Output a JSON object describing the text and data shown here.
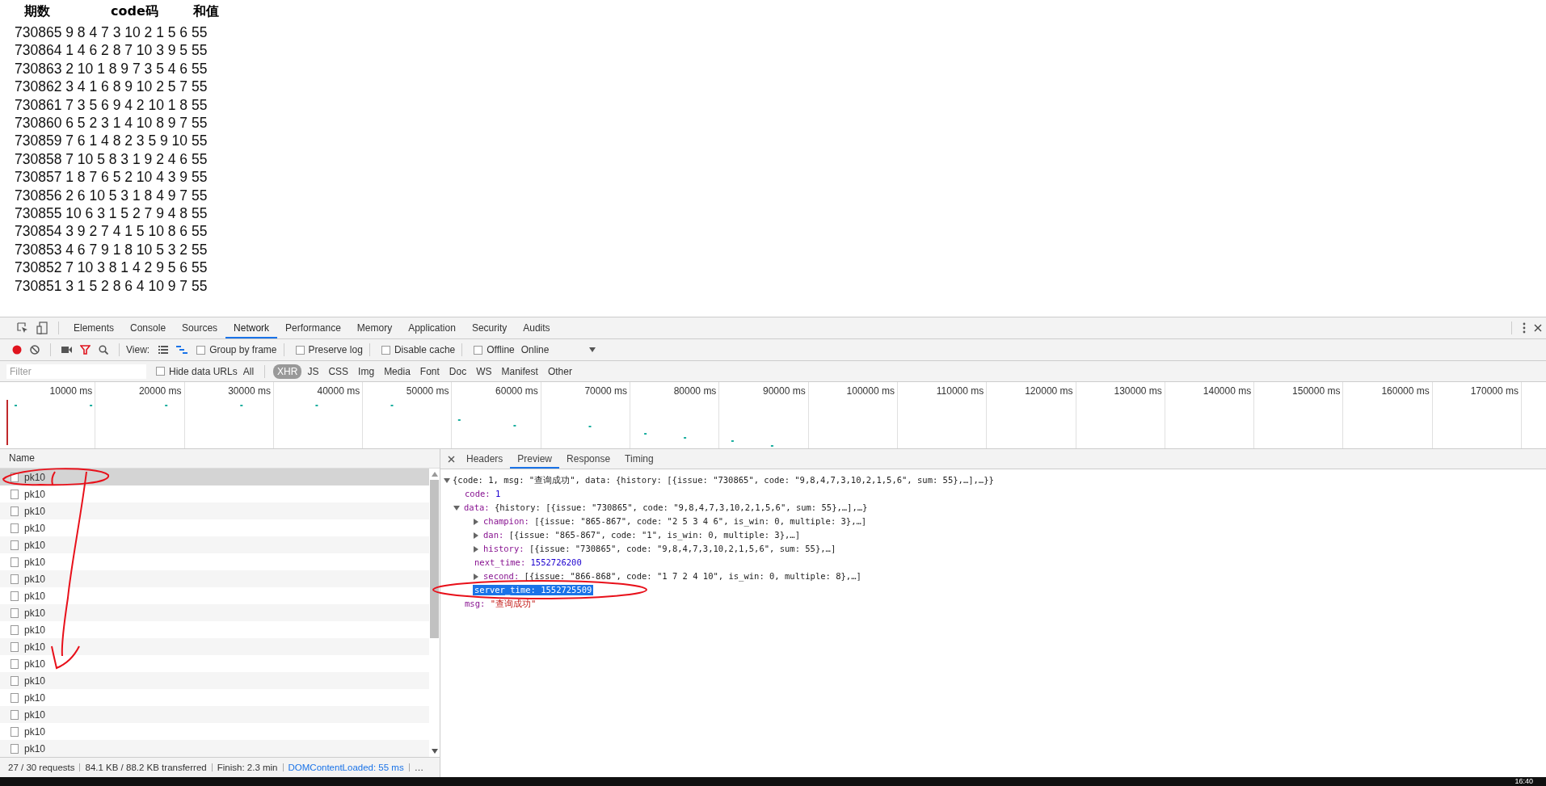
{
  "page": {
    "headers": [
      "期数",
      "code码",
      "和值"
    ],
    "rows": [
      "730865 9 8 4 7 3 10 2 1 5 6 55",
      "730864 1 4 6 2 8 7 10 3 9 5 55",
      "730863 2 10 1 8 9 7 3 5 4 6 55",
      "730862 3 4 1 6 8 9 10 2 5 7 55",
      "730861 7 3 5 6 9 4 2 10 1 8 55",
      "730860 6 5 2 3 1 4 10 8 9 7 55",
      "730859 7 6 1 4 8 2 3 5 9 10 55",
      "730858 7 10 5 8 3 1 9 2 4 6 55",
      "730857 1 8 7 6 5 2 10 4 3 9 55",
      "730856 2 6 10 5 3 1 8 4 9 7 55",
      "730855 10 6 3 1 5 2 7 9 4 8 55",
      "730854 3 9 2 7 4 1 5 10 8 6 55",
      "730853 4 6 7 9 1 8 10 5 3 2 55",
      "730852 7 10 3 8 1 4 2 9 5 6 55",
      "730851 3 1 5 2 8 6 4 10 9 7 55"
    ]
  },
  "devtools": {
    "tabs": [
      {
        "label": "Elements",
        "selected": false
      },
      {
        "label": "Console",
        "selected": false
      },
      {
        "label": "Sources",
        "selected": false
      },
      {
        "label": "Network",
        "selected": true
      },
      {
        "label": "Performance",
        "selected": false
      },
      {
        "label": "Memory",
        "selected": false
      },
      {
        "label": "Application",
        "selected": false
      },
      {
        "label": "Security",
        "selected": false
      },
      {
        "label": "Audits",
        "selected": false
      }
    ],
    "toolbar": {
      "recording": true,
      "filter_active": true,
      "view_label": "View:",
      "waterfall_selected": true,
      "checkboxes": [
        {
          "label": "Group by frame",
          "checked": false
        },
        {
          "label": "Preserve log",
          "checked": false
        },
        {
          "label": "Disable cache",
          "checked": false
        },
        {
          "label": "Offline",
          "checked": false
        }
      ],
      "throttle": "Online"
    },
    "filter": {
      "placeholder": "Filter",
      "hide_data_urls": {
        "label": "Hide data URLs",
        "checked": false
      },
      "types": [
        {
          "label": "All",
          "selected": false
        },
        {
          "label": "XHR",
          "selected": true
        },
        {
          "label": "JS",
          "selected": false
        },
        {
          "label": "CSS",
          "selected": false
        },
        {
          "label": "Img",
          "selected": false
        },
        {
          "label": "Media",
          "selected": false
        },
        {
          "label": "Font",
          "selected": false
        },
        {
          "label": "Doc",
          "selected": false
        },
        {
          "label": "WS",
          "selected": false
        },
        {
          "label": "Manifest",
          "selected": false
        },
        {
          "label": "Other",
          "selected": false
        }
      ]
    },
    "timeline_labels": [
      "10000 ms",
      "20000 ms",
      "30000 ms",
      "40000 ms",
      "50000 ms",
      "60000 ms",
      "70000 ms",
      "80000 ms",
      "90000 ms",
      "100000 ms",
      "110000 ms",
      "120000 ms",
      "130000 ms",
      "140000 ms",
      "150000 ms",
      "160000 ms",
      "170000 ms"
    ],
    "requests": {
      "column": "Name",
      "items": [
        {
          "name": "pk10",
          "selected": true
        },
        {
          "name": "pk10",
          "selected": false
        },
        {
          "name": "pk10",
          "selected": false
        },
        {
          "name": "pk10",
          "selected": false
        },
        {
          "name": "pk10",
          "selected": false
        },
        {
          "name": "pk10",
          "selected": false
        },
        {
          "name": "pk10",
          "selected": false
        },
        {
          "name": "pk10",
          "selected": false
        },
        {
          "name": "pk10",
          "selected": false
        },
        {
          "name": "pk10",
          "selected": false
        },
        {
          "name": "pk10",
          "selected": false
        },
        {
          "name": "pk10",
          "selected": false
        },
        {
          "name": "pk10",
          "selected": false
        },
        {
          "name": "pk10",
          "selected": false
        },
        {
          "name": "pk10",
          "selected": false
        },
        {
          "name": "pk10",
          "selected": false
        },
        {
          "name": "pk10",
          "selected": false
        }
      ]
    },
    "detail_tabs": [
      {
        "label": "Headers",
        "selected": false
      },
      {
        "label": "Preview",
        "selected": true
      },
      {
        "label": "Response",
        "selected": false
      },
      {
        "label": "Timing",
        "selected": false
      }
    ],
    "preview": {
      "text": "{code: 1, msg: \"查询成功\", data: {history: [{issue: \"730865\", code: \"9,8,4,7,3,10,2,1,5,6\", sum: 55},…],…}}",
      "expanded": true,
      "children": [
        {
          "key": "code:",
          "value": "1",
          "kind": "number",
          "selected": false
        },
        {
          "key": "data:",
          "value": "{history: [{issue: \"730865\", code: \"9,8,4,7,3,10,2,1,5,6\", sum: 55},…],…}",
          "kind": "object",
          "expanded": true,
          "selected": false,
          "children": [
            {
              "key": "champion:",
              "value": "[{issue: \"865-867\", code: \"2 5 3 4 6\", is_win: 0, multiple: 3},…]",
              "kind": "object",
              "expanded": false,
              "selected": false
            },
            {
              "key": "dan:",
              "value": "[{issue: \"865-867\", code: \"1\", is_win: 0, multiple: 3},…]",
              "kind": "object",
              "expanded": false,
              "selected": false
            },
            {
              "key": "history:",
              "value": "[{issue: \"730865\", code: \"9,8,4,7,3,10,2,1,5,6\", sum: 55},…]",
              "kind": "object",
              "expanded": false,
              "selected": false
            },
            {
              "key": "next_time:",
              "value": "1552726200",
              "kind": "number",
              "selected": false
            },
            {
              "key": "second:",
              "value": "[{issue: \"866-868\", code: \"1 7 2 4 10\", is_win: 0, multiple: 8},…]",
              "kind": "object",
              "expanded": false,
              "selected": false
            },
            {
              "key": "server_time:",
              "value": "1552725509",
              "kind": "number",
              "selected": true
            }
          ]
        },
        {
          "key": "msg:",
          "value": "\"查询成功\"",
          "kind": "string",
          "selected": false
        }
      ]
    },
    "status": [
      {
        "text": "27 / 30 requests",
        "kind": "plain"
      },
      {
        "text": "84.1 KB / 88.2 KB transferred",
        "kind": "plain"
      },
      {
        "text": "Finish: 2.3 min",
        "kind": "plain"
      },
      {
        "text": "DOMContentLoaded: 55 ms",
        "kind": "link"
      },
      {
        "text": "…",
        "kind": "plain"
      }
    ]
  },
  "taskbar": {
    "clock": "16:40"
  }
}
